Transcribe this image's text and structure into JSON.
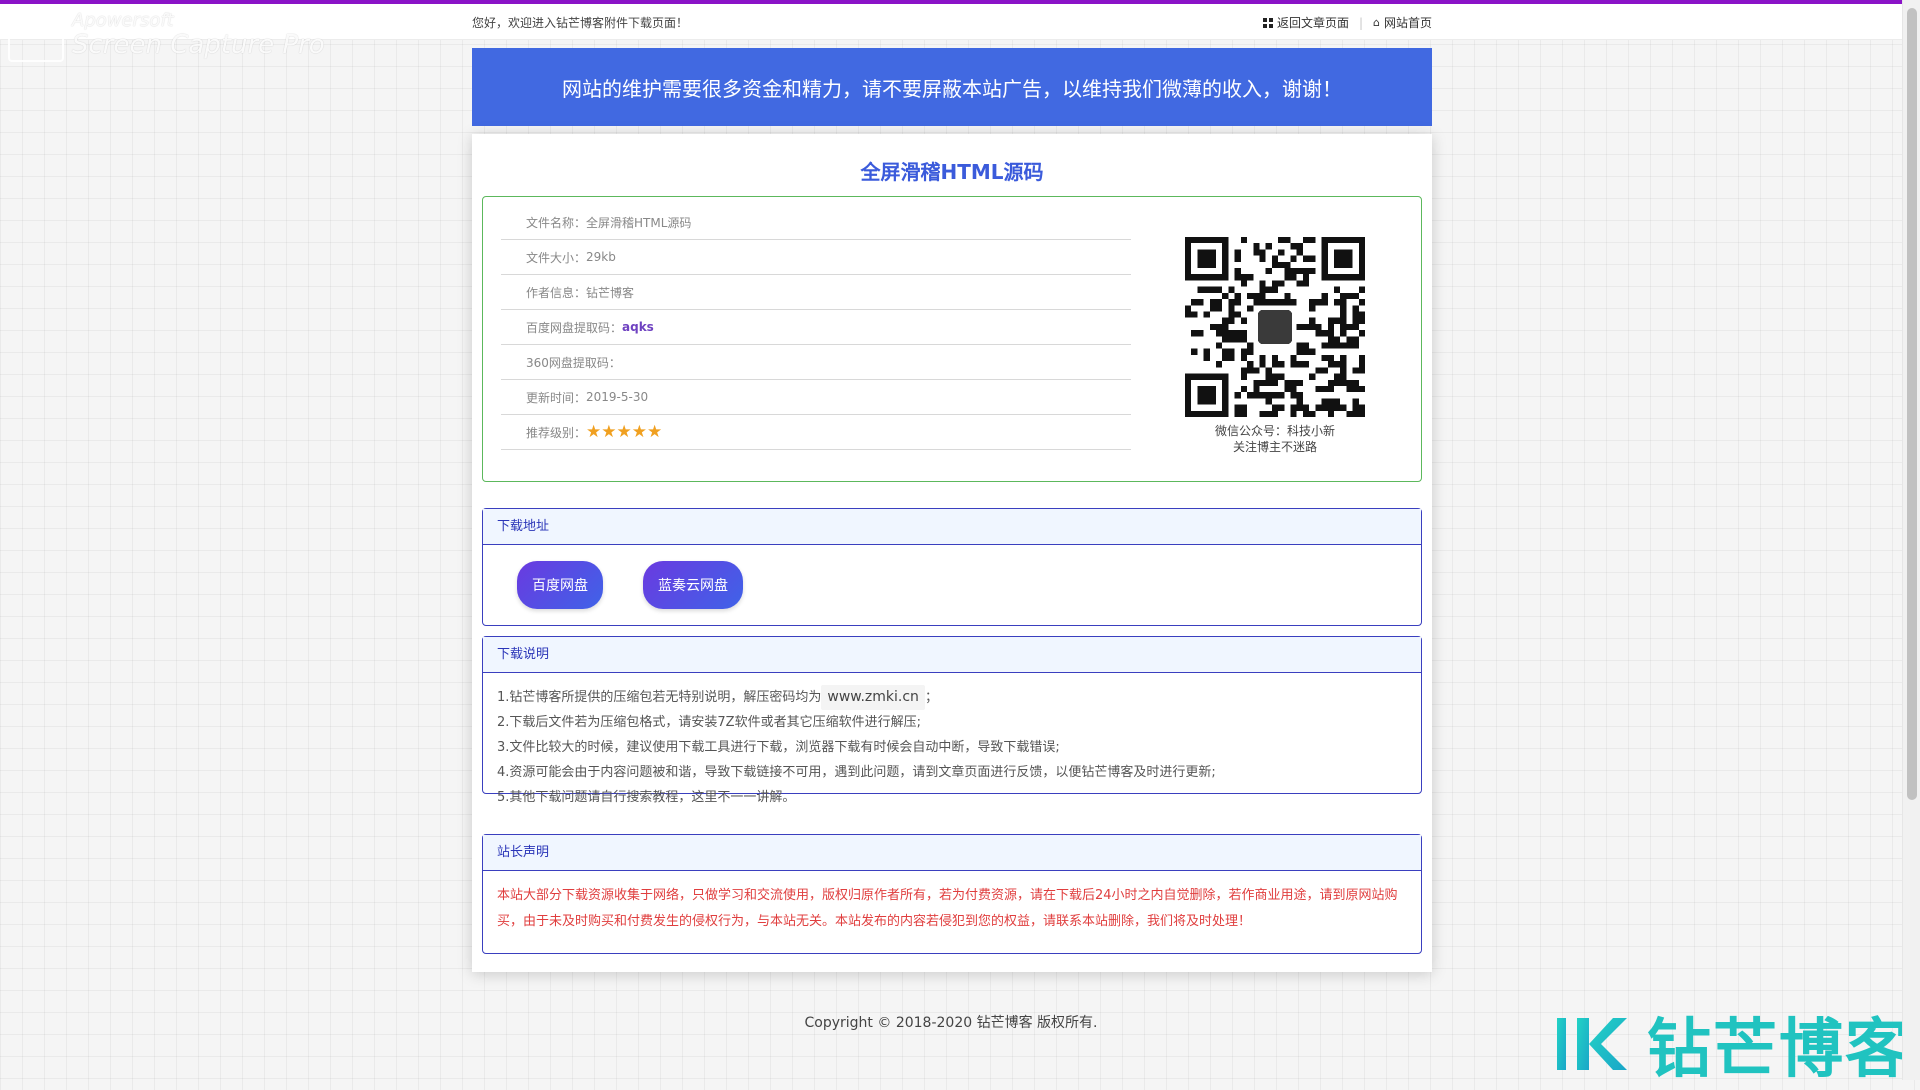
{
  "topbar": {
    "welcome": "您好，欢迎进入钻芒博客附件下载页面！",
    "back_link": "返回文章页面",
    "home_link": "网站首页",
    "separator": "|"
  },
  "watermark": {
    "brand": "Apowersoft",
    "product": "Screen Capture Pro"
  },
  "banner": {
    "text": "网站的维护需要很多资金和精力，请不要屏蔽本站广告，以维持我们微薄的收入，谢谢！"
  },
  "card": {
    "title": "全屏滑稽HTML源码"
  },
  "info": {
    "rows": [
      {
        "label": "文件名称：",
        "value": "全屏滑稽HTML源码"
      },
      {
        "label": "文件大小：",
        "value": "29kb"
      },
      {
        "label": "作者信息：",
        "value": "钻芒博客"
      },
      {
        "label": "百度网盘提取码：",
        "value": "aqks"
      },
      {
        "label": "360网盘提取码：",
        "value": ""
      },
      {
        "label": "更新时间：",
        "value": "2019-5-30"
      },
      {
        "label": "推荐级别：",
        "value": ""
      }
    ],
    "rating": 5,
    "stars": "★★★★★"
  },
  "qr": {
    "caption_line1": "微信公众号：科技小新",
    "caption_line2": "关注博主不迷路"
  },
  "download": {
    "title": "下载地址",
    "buttons": [
      "百度网盘",
      "蓝奏云网盘"
    ]
  },
  "notes": {
    "title": "下载说明",
    "line1_prefix": "1.钻芒博客所提供的压缩包若无特别说明，解压密码均为",
    "line1_domain": "www.zmki.cn",
    "line1_suffix": "；",
    "line2": "2.下载后文件若为压缩包格式，请安装7Z软件或者其它压缩软件进行解压;",
    "line3": "3.文件比较大的时候，建议使用下载工具进行下载，浏览器下载有时候会自动中断，导致下载错误;",
    "line4": "4.资源可能会由于内容问题被和谐，导致下载链接不可用，遇到此问题，请到文章页面进行反馈，以便钻芒博客及时进行更新;",
    "line5": "5.其他下载问题请自行搜索教程，这里不一一讲解。"
  },
  "disclaimer": {
    "title": "站长声明",
    "text": "本站大部分下载资源收集于网络，只做学习和交流使用，版权归原作者所有，若为付费资源，请在下载后24小时之内自觉删除，若作商业用途，请到原网站购买，由于未及时购买和付费发生的侵权行为，与本站无关。本站发布的内容若侵犯到您的权益，请联系本站删除，我们将及时处理！"
  },
  "footer": {
    "text": "Copyright © 2018-2020 钻芒博客 版权所有."
  },
  "brand_logo": {
    "text": "钻芒博客",
    "color": "#20c3c0"
  },
  "colors": {
    "top_line": "#8a13c7",
    "banner": "#4169e1",
    "title": "#3b5bdb",
    "info_border": "#5cb85c",
    "panel_border": "#3a3fbf",
    "star": "#f0a020",
    "disclaimer_text": "#e03e3e"
  }
}
